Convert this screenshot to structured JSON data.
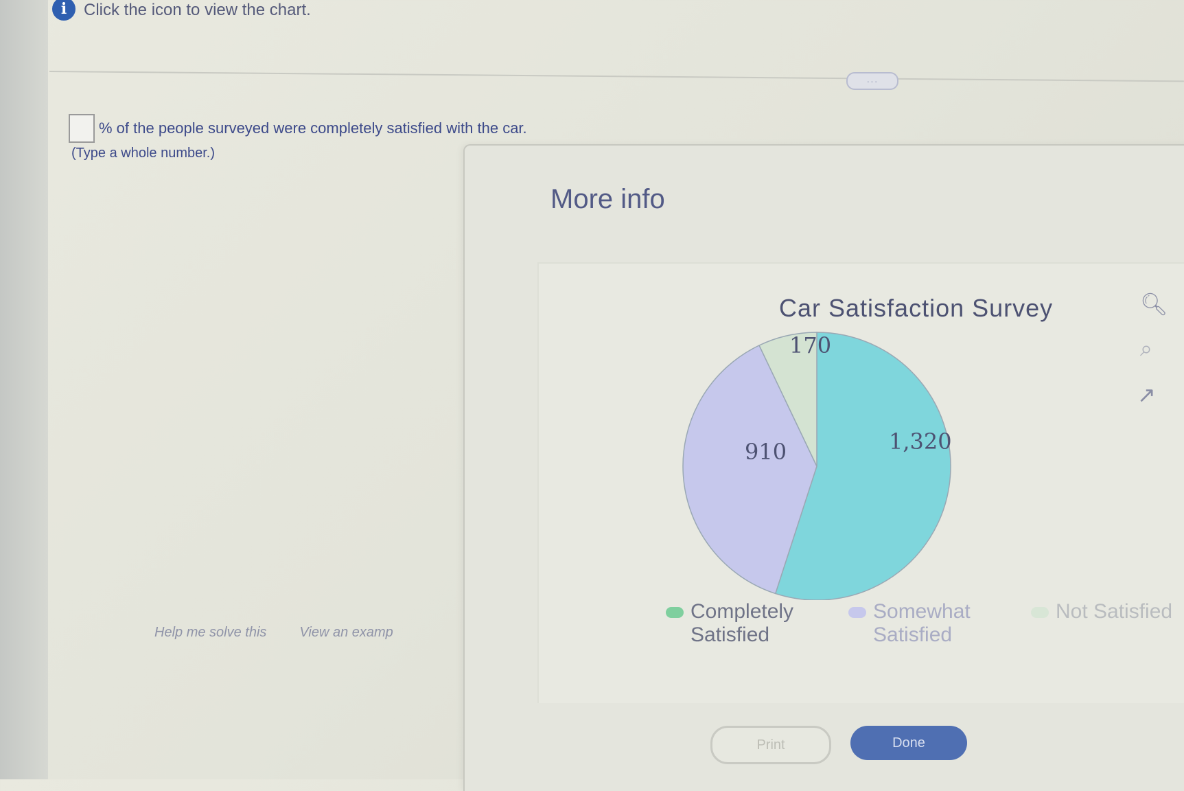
{
  "header": {
    "instruction": "Click the icon to view the chart.",
    "info_icon": "info-icon"
  },
  "expand_label": "",
  "question": {
    "text": "% of the people surveyed were completely satisfied with the car.",
    "answer_value": "",
    "hint": "(Type a whole number.)"
  },
  "links": {
    "help": "Help me solve this",
    "example": "View an examp"
  },
  "dialog": {
    "title": "More info",
    "buttons": {
      "print": "Print",
      "done": "Done"
    },
    "icons": [
      "zoom-in-icon",
      "zoom-out-icon",
      "popout-icon"
    ]
  },
  "chart_data": {
    "type": "pie",
    "title": "Car Satisfaction Survey",
    "series": [
      {
        "name": "Completely Satisfied",
        "value": 1320,
        "label": "1,320",
        "color": "#7fd6dc"
      },
      {
        "name": "Somewhat Satisfied",
        "value": 910,
        "label": "910",
        "color": "#c6c8ec"
      },
      {
        "name": "Not Satisfied",
        "value": 170,
        "label": "170",
        "color": "#d4e3d2"
      }
    ],
    "legend": {
      "position": "bottom",
      "items": [
        "Completely Satisfied",
        "Somewhat Satisfied",
        "Not Satisfied"
      ]
    }
  }
}
